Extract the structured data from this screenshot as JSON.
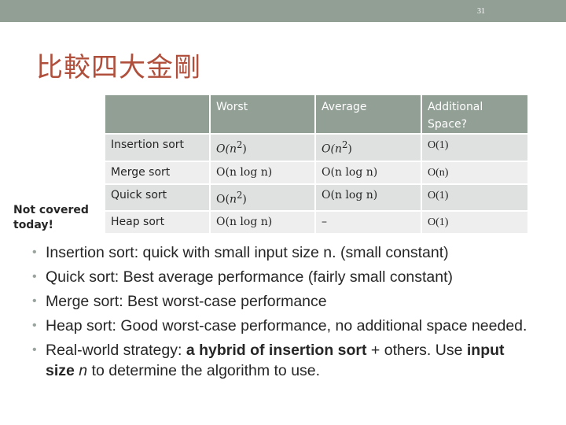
{
  "header": {
    "slide_number": "31"
  },
  "title": "比較四大金剛",
  "side_note": {
    "line1": "Not covered",
    "line2": "today!"
  },
  "table": {
    "headers": [
      "",
      "Worst",
      "Average",
      "Additional",
      "Space?"
    ],
    "rows": [
      {
        "name": "Insertion sort",
        "worst_pre": "O(",
        "worst_var": "n",
        "worst_sup": "2",
        "worst_post": ")",
        "avg_pre": "O(",
        "avg_var": "n",
        "avg_sup": "2",
        "avg_post": ")",
        "space": "O(1)"
      },
      {
        "name": "Merge sort",
        "worst": "O(n log n)",
        "average": "O(n log n)",
        "space": "O(n)"
      },
      {
        "name": "Quick sort",
        "worst_pre": "O(",
        "worst_var": "n",
        "worst_sup": "2",
        "worst_post": ")",
        "average": "O(n log n)",
        "space": "O(1)"
      },
      {
        "name": "Heap sort",
        "worst": "O(n log n)",
        "average": "–",
        "space": "O(1)"
      }
    ]
  },
  "bullets": [
    {
      "text": "Insertion sort: quick with small input size n. (small constant)"
    },
    {
      "text": "Quick sort: Best average performance (fairly small constant)"
    },
    {
      "text": "Merge sort: Best worst-case performance"
    },
    {
      "text": "Heap sort: Good worst-case performance, no additional space needed."
    },
    {
      "pre": "Real-world strategy: ",
      "bold1": "a hybrid of insertion sort",
      "mid": " + others. Use ",
      "bold2": "input size",
      "sp": " ",
      "ital": "n",
      "post": " to determine the algorithm to use."
    }
  ]
}
